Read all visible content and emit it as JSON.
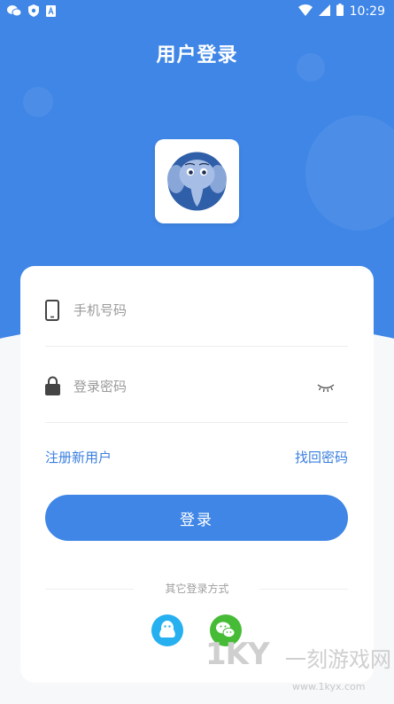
{
  "status_bar": {
    "time": "10:29",
    "icons": [
      "wechat-icon",
      "shield-icon",
      "app-icon",
      "wifi-icon",
      "signal-icon",
      "battery-icon"
    ]
  },
  "header": {
    "title": "用户登录"
  },
  "form": {
    "phone_placeholder": "手机号码",
    "password_placeholder": "登录密码",
    "register_link": "注册新用户",
    "forgot_link": "找回密码",
    "login_button": "登录"
  },
  "other_login": {
    "label": "其它登录方式",
    "options": [
      "qq-icon",
      "wechat-icon"
    ]
  },
  "watermark": {
    "brand": "1KY",
    "brand_cn": "一刻游戏网",
    "url": "www.1kyx.com"
  },
  "colors": {
    "primary": "#3f86e6",
    "link": "#3a7fe0",
    "qq": "#26b0f0",
    "wechat": "#46bb36"
  }
}
